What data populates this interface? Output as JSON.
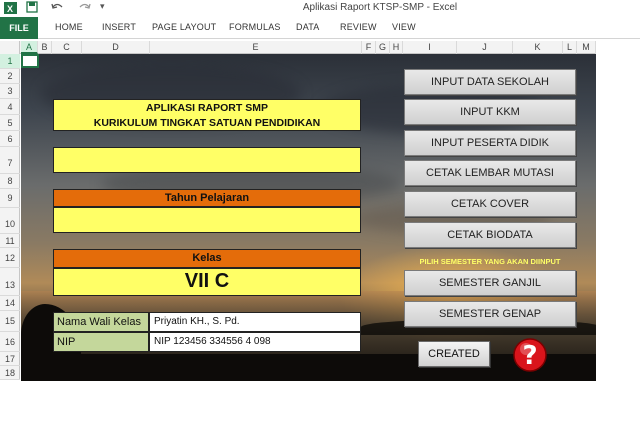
{
  "window": {
    "title": "Aplikasi Raport KTSP-SMP - Excel",
    "controls": [
      "?",
      "—",
      "□",
      "✕"
    ]
  },
  "ribbon": {
    "file_label": "FILE",
    "tabs": [
      "HOME",
      "INSERT",
      "PAGE LAYOUT",
      "FORMULAS",
      "DATA",
      "REVIEW",
      "VIEW"
    ]
  },
  "grid": {
    "columns": [
      "A",
      "B",
      "C",
      "D",
      "E",
      "F",
      "G",
      "H",
      "I",
      "J",
      "K",
      "L",
      "M"
    ],
    "rows": [
      "1",
      "2",
      "3",
      "4",
      "5",
      "6",
      "7",
      "8",
      "9",
      "10",
      "11",
      "12",
      "13",
      "14",
      "15",
      "16",
      "17",
      "18"
    ]
  },
  "form": {
    "title_line1": "APLIKASI RAPORT SMP",
    "title_line2": "KURIKULUM TINGKAT SATUAN PENDIDIKAN",
    "school_name": "",
    "tahun_label": "Tahun Pelajaran",
    "tahun_value": "",
    "kelas_label": "Kelas",
    "kelas_value": "VII C",
    "wali_label": "Nama Wali Kelas",
    "wali_value": "Priyatin KH., S. Pd.",
    "nip_label": "NIP",
    "nip_value": "NIP 123456 334556 4 098"
  },
  "buttons": {
    "input_sekolah": "INPUT DATA SEKOLAH",
    "input_kkm": "INPUT KKM",
    "input_peserta": "INPUT PESERTA DIDIK",
    "cetak_mutasi": "CETAK LEMBAR MUTASI",
    "cetak_cover": "CETAK COVER",
    "cetak_biodata": "CETAK BIODATA",
    "semester_hint": "PILIH SEMESTER YANG AKAN DIINPUT",
    "semester_ganjil": "SEMESTER GANJIL",
    "semester_genap": "SEMESTER GENAP",
    "created": "CREATED",
    "help_glyph": "?"
  },
  "colors": {
    "excel_green": "#217346",
    "yellow_field": "#ffff66",
    "orange_bar": "#e46c0a",
    "label_green": "#c4d79b",
    "help_red": "#d9141b"
  }
}
